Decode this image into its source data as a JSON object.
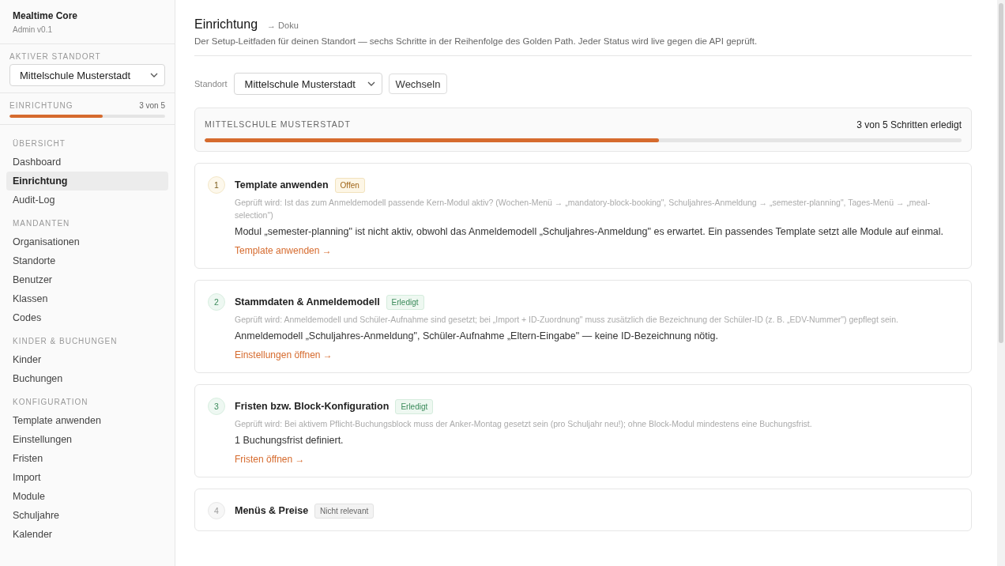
{
  "app": {
    "title": "Mealtime Core",
    "version": "Admin v0.1"
  },
  "sidebar": {
    "location_label": "AKTIVER STANDORT",
    "location_value": "Mittelschule Musterstadt",
    "setup": {
      "label": "EINRICHTUNG",
      "count": "3 von 5",
      "level": 0.6
    },
    "sections": [
      {
        "title": "ÜBERSICHT",
        "items": [
          {
            "label": "Dashboard",
            "selected": false
          },
          {
            "label": "Einrichtung",
            "selected": true
          },
          {
            "label": "Audit-Log",
            "selected": false
          }
        ]
      },
      {
        "title": "MANDANTEN",
        "items": [
          {
            "label": "Organisationen",
            "selected": false
          },
          {
            "label": "Standorte",
            "selected": false
          },
          {
            "label": "Benutzer",
            "selected": false
          },
          {
            "label": "Klassen",
            "selected": false
          },
          {
            "label": "Codes",
            "selected": false
          }
        ]
      },
      {
        "title": "KINDER & BUCHUNGEN",
        "items": [
          {
            "label": "Kinder",
            "selected": false
          },
          {
            "label": "Buchungen",
            "selected": false
          }
        ]
      },
      {
        "title": "KONFIGURATION",
        "items": [
          {
            "label": "Template anwenden",
            "selected": false
          },
          {
            "label": "Einstellungen",
            "selected": false
          },
          {
            "label": "Fristen",
            "selected": false
          },
          {
            "label": "Import",
            "selected": false
          },
          {
            "label": "Module",
            "selected": false
          },
          {
            "label": "Schuljahre",
            "selected": false
          },
          {
            "label": "Kalender",
            "selected": false
          }
        ]
      }
    ]
  },
  "header": {
    "title": "Einrichtung",
    "doc_link": "→ Doku",
    "description": "Der Setup-Leitfaden für deinen Standort — sechs Schritte in der Reihenfolge des Golden Path. Jeder Status wird live gegen die API geprüft."
  },
  "location_picker": {
    "label": "Standort",
    "value": "Mittelschule Musterstadt",
    "button": "Wechseln"
  },
  "progress": {
    "title": "MITTELSCHULE MUSTERSTADT",
    "summary": "3 von 5 Schritten erledigt",
    "level": 0.6
  },
  "steps": [
    {
      "number": "1",
      "title": "Template anwenden",
      "status": "Offen",
      "kind": "open",
      "check": "Geprüft wird: Ist das zum Anmeldemodell passende Kern-Modul aktiv? (Wochen-Menü → „mandatory-block-booking\", Schuljahres-Anmeldung → „semester-planning\", Tages-Menü → „meal-selection\")",
      "message": "Modul „semester-planning\" ist nicht aktiv, obwohl das Anmeldemodell „Schuljahres-Anmeldung\" es erwartet. Ein passendes Template setzt alle Module auf einmal.",
      "link": "Template anwenden →"
    },
    {
      "number": "2",
      "title": "Stammdaten & Anmeldemodell",
      "status": "Erledigt",
      "kind": "done",
      "check": "Geprüft wird: Anmeldemodell und Schüler-Aufnahme sind gesetzt; bei „Import + ID-Zuordnung\" muss zusätzlich die Bezeichnung der Schüler-ID (z. B. „EDV-Nummer\") gepflegt sein.",
      "message": "Anmeldemodell „Schuljahres-Anmeldung\", Schüler-Aufnahme „Eltern-Eingabe\" — keine ID-Bezeichnung nötig.",
      "link": "Einstellungen öffnen →"
    },
    {
      "number": "3",
      "title": "Fristen bzw. Block-Konfiguration",
      "status": "Erledigt",
      "kind": "done",
      "check": "Geprüft wird: Bei aktivem Pflicht-Buchungsblock muss der Anker-Montag gesetzt sein (pro Schuljahr neu!); ohne Block-Modul mindestens eine Buchungsfrist.",
      "message": "1 Buchungsfrist definiert.",
      "link": "Fristen öffnen →"
    },
    {
      "number": "4",
      "title": "Menüs & Preise",
      "status": "Nicht relevant",
      "kind": "na"
    }
  ]
}
